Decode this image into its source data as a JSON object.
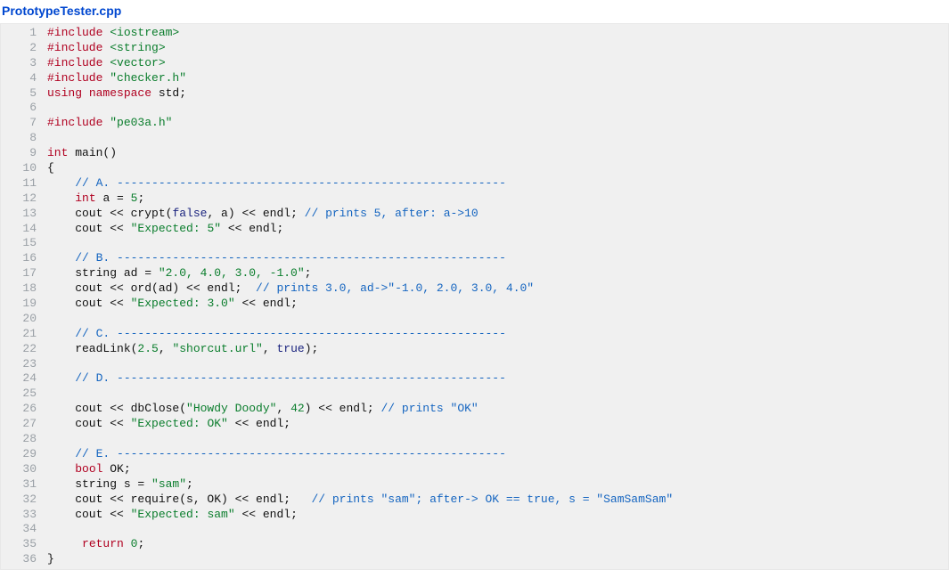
{
  "filename": "PrototypeTester.cpp",
  "lines": [
    [
      {
        "t": "#include ",
        "c": "pp"
      },
      {
        "t": "<iostream>",
        "c": "hdr"
      }
    ],
    [
      {
        "t": "#include ",
        "c": "pp"
      },
      {
        "t": "<string>",
        "c": "hdr"
      }
    ],
    [
      {
        "t": "#include ",
        "c": "pp"
      },
      {
        "t": "<vector>",
        "c": "hdr"
      }
    ],
    [
      {
        "t": "#include ",
        "c": "pp"
      },
      {
        "t": "\"checker.h\"",
        "c": "hdr"
      }
    ],
    [
      {
        "t": "using ",
        "c": "kw"
      },
      {
        "t": "namespace ",
        "c": "kw"
      },
      {
        "t": "std;",
        "c": "id"
      }
    ],
    [],
    [
      {
        "t": "#include ",
        "c": "pp"
      },
      {
        "t": "\"pe03a.h\"",
        "c": "hdr"
      }
    ],
    [],
    [
      {
        "t": "int ",
        "c": "kw"
      },
      {
        "t": "main()",
        "c": "id"
      }
    ],
    [
      {
        "t": "{",
        "c": "id"
      }
    ],
    [
      {
        "t": "    ",
        "c": "id"
      },
      {
        "t": "// A. --------------------------------------------------------",
        "c": "cmt"
      }
    ],
    [
      {
        "t": "    ",
        "c": "id"
      },
      {
        "t": "int ",
        "c": "kw"
      },
      {
        "t": "a = ",
        "c": "id"
      },
      {
        "t": "5",
        "c": "num"
      },
      {
        "t": ";",
        "c": "id"
      }
    ],
    [
      {
        "t": "    cout << crypt(",
        "c": "id"
      },
      {
        "t": "false",
        "c": "kwb"
      },
      {
        "t": ", a) << endl; ",
        "c": "id"
      },
      {
        "t": "// prints 5, after: a->10",
        "c": "cmt"
      }
    ],
    [
      {
        "t": "    cout << ",
        "c": "id"
      },
      {
        "t": "\"Expected: 5\"",
        "c": "str"
      },
      {
        "t": " << endl;",
        "c": "id"
      }
    ],
    [],
    [
      {
        "t": "    ",
        "c": "id"
      },
      {
        "t": "// B. --------------------------------------------------------",
        "c": "cmt"
      }
    ],
    [
      {
        "t": "    string ad = ",
        "c": "id"
      },
      {
        "t": "\"2.0, 4.0, 3.0, -1.0\"",
        "c": "str"
      },
      {
        "t": ";",
        "c": "id"
      }
    ],
    [
      {
        "t": "    cout << ord(ad) << endl;  ",
        "c": "id"
      },
      {
        "t": "// prints 3.0, ad->\"-1.0, 2.0, 3.0, 4.0\"",
        "c": "cmt"
      }
    ],
    [
      {
        "t": "    cout << ",
        "c": "id"
      },
      {
        "t": "\"Expected: 3.0\"",
        "c": "str"
      },
      {
        "t": " << endl;",
        "c": "id"
      }
    ],
    [],
    [
      {
        "t": "    ",
        "c": "id"
      },
      {
        "t": "// C. --------------------------------------------------------",
        "c": "cmt"
      }
    ],
    [
      {
        "t": "    readLink(",
        "c": "id"
      },
      {
        "t": "2.5",
        "c": "num"
      },
      {
        "t": ", ",
        "c": "id"
      },
      {
        "t": "\"shorcut.url\"",
        "c": "str"
      },
      {
        "t": ", ",
        "c": "id"
      },
      {
        "t": "true",
        "c": "kwb"
      },
      {
        "t": ");",
        "c": "id"
      }
    ],
    [],
    [
      {
        "t": "    ",
        "c": "id"
      },
      {
        "t": "// D. --------------------------------------------------------",
        "c": "cmt"
      }
    ],
    [],
    [
      {
        "t": "    cout << dbClose(",
        "c": "id"
      },
      {
        "t": "\"Howdy Doody\"",
        "c": "str"
      },
      {
        "t": ", ",
        "c": "id"
      },
      {
        "t": "42",
        "c": "num"
      },
      {
        "t": ") << endl; ",
        "c": "id"
      },
      {
        "t": "// prints \"OK\"",
        "c": "cmt"
      }
    ],
    [
      {
        "t": "    cout << ",
        "c": "id"
      },
      {
        "t": "\"Expected: OK\"",
        "c": "str"
      },
      {
        "t": " << endl;",
        "c": "id"
      }
    ],
    [],
    [
      {
        "t": "    ",
        "c": "id"
      },
      {
        "t": "// E. --------------------------------------------------------",
        "c": "cmt"
      }
    ],
    [
      {
        "t": "    ",
        "c": "id"
      },
      {
        "t": "bool ",
        "c": "kw"
      },
      {
        "t": "OK;",
        "c": "id"
      }
    ],
    [
      {
        "t": "    string s = ",
        "c": "id"
      },
      {
        "t": "\"sam\"",
        "c": "str"
      },
      {
        "t": ";",
        "c": "id"
      }
    ],
    [
      {
        "t": "    cout << require(s, OK) << endl;   ",
        "c": "id"
      },
      {
        "t": "// prints \"sam\"; after-> OK == true, s = \"SamSamSam\"",
        "c": "cmt"
      }
    ],
    [
      {
        "t": "    cout << ",
        "c": "id"
      },
      {
        "t": "\"Expected: sam\"",
        "c": "str"
      },
      {
        "t": " << endl;",
        "c": "id"
      }
    ],
    [],
    [
      {
        "t": "     ",
        "c": "id"
      },
      {
        "t": "return ",
        "c": "kw"
      },
      {
        "t": "0",
        "c": "num"
      },
      {
        "t": ";",
        "c": "id"
      }
    ],
    [
      {
        "t": "}",
        "c": "id"
      }
    ]
  ]
}
